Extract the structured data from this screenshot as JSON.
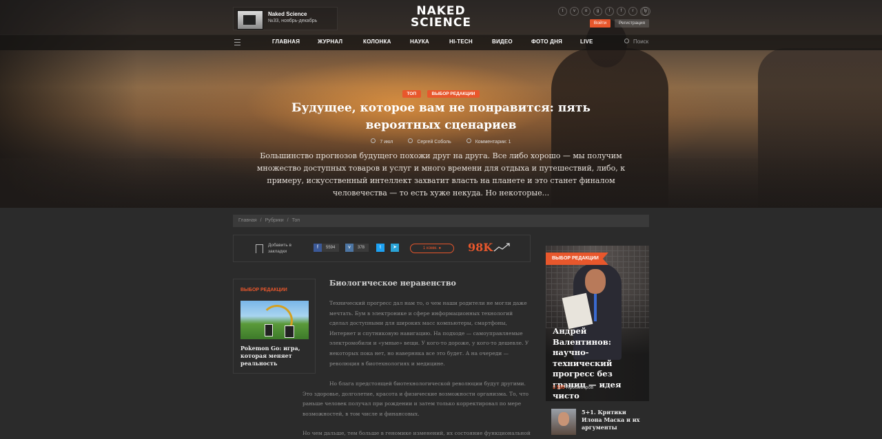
{
  "header": {
    "magazine": {
      "title": "Naked Science",
      "issue": "№33, ноябрь-декабрь"
    },
    "logo": {
      "line1": "NAKED",
      "line2": "SCIENCE"
    },
    "socials": [
      {
        "name": "twitter-icon",
        "glyph": "t"
      },
      {
        "name": "vk-icon",
        "glyph": "v"
      },
      {
        "name": "odnoklassniki-icon",
        "glyph": "o"
      },
      {
        "name": "google-plus-icon",
        "glyph": "g"
      },
      {
        "name": "facebook-icon",
        "glyph": "f"
      },
      {
        "name": "flipboard-icon",
        "glyph": "f"
      },
      {
        "name": "rss-icon",
        "glyph": "r"
      },
      {
        "name": "telegram-icon",
        "glyph": "t"
      },
      {
        "name": "youtube-icon",
        "glyph": "y"
      }
    ],
    "login_label": "Войти",
    "register_label": "Регистрация"
  },
  "nav": {
    "items": [
      "ГЛАВНАЯ",
      "ЖУРНАЛ",
      "КОЛОНКА",
      "НАУКА",
      "HI-TECH",
      "ВИДЕО",
      "ФОТО ДНЯ",
      "LIVE"
    ],
    "search_placeholder": "Поиск"
  },
  "hero": {
    "tags": [
      "ТОП",
      "ВЫБОР РЕДАКЦИИ"
    ],
    "title": "Будущее, которое вам не понравится: пять вероятных сценариев",
    "date": "7 июл",
    "author": "Сергей Соболь",
    "comments": "Комментарии: 1",
    "lead": "Большинство прогнозов будущего похожи друг на друга. Все либо хорошо — мы получим множество доступных товаров и услуг и много времени для отдыха и путешествий, либо, к примеру, искусственный интеллект захватит власть на планете и это станет финалом человечества — то есть хуже некуда. Но некоторые..."
  },
  "breadcrumb": [
    "Главная",
    "Рубрики",
    "Топ"
  ],
  "share": {
    "bookmark_label": "Добавить в закладки",
    "facebook_count": "5594",
    "vk_count": "378",
    "comments_label": "1 комм.",
    "views": "98K"
  },
  "editors_choice_left": {
    "header": "ВЫБОР РЕДАКЦИИ",
    "caption": "Pokemon Go: игра, которая меняет реальность"
  },
  "article": {
    "heading": "Биологическое неравенство",
    "p1": "Технический прогресс дал нам то, о чем наши родители не могли даже мечтать. Бум в электронике и сфере информационных технологий сделал доступными для широких масс компьютеры, смартфоны, Интернет и спутниковую навигацию. На подходе — самоуправляемые электромобили и «умные» вещи. У кого-то дороже, у кого-то дешевле. У некоторых пока нет, но наверняка все это будет. А на очереди — революция в биотехнологиях и медицине.",
    "p2": "Но блага предстоящей биотехнологической революции будут другими. Это здоровье, долголетие, красота и физические возможности организма. То, что раньше человек получал при рождении и затем только корректировал по мере возможностей, в том числе и финансовых.",
    "p3": "Но чем дальше, тем больше в геномике изменений, их состояние функциональной"
  },
  "editors_choice_right": {
    "flag": "ВЫБОР РЕДАКЦИИ",
    "title": "Андрей Валентинов: научно-технический прогресс без границ — идея чисто американская",
    "views_count": "1 535",
    "views_label": "Просмотров"
  },
  "next_article": {
    "title": "5+1. Критики Илона Маска и их аргументы"
  },
  "colors": {
    "accent": "#e8572c",
    "background": "#2b2b2b"
  }
}
